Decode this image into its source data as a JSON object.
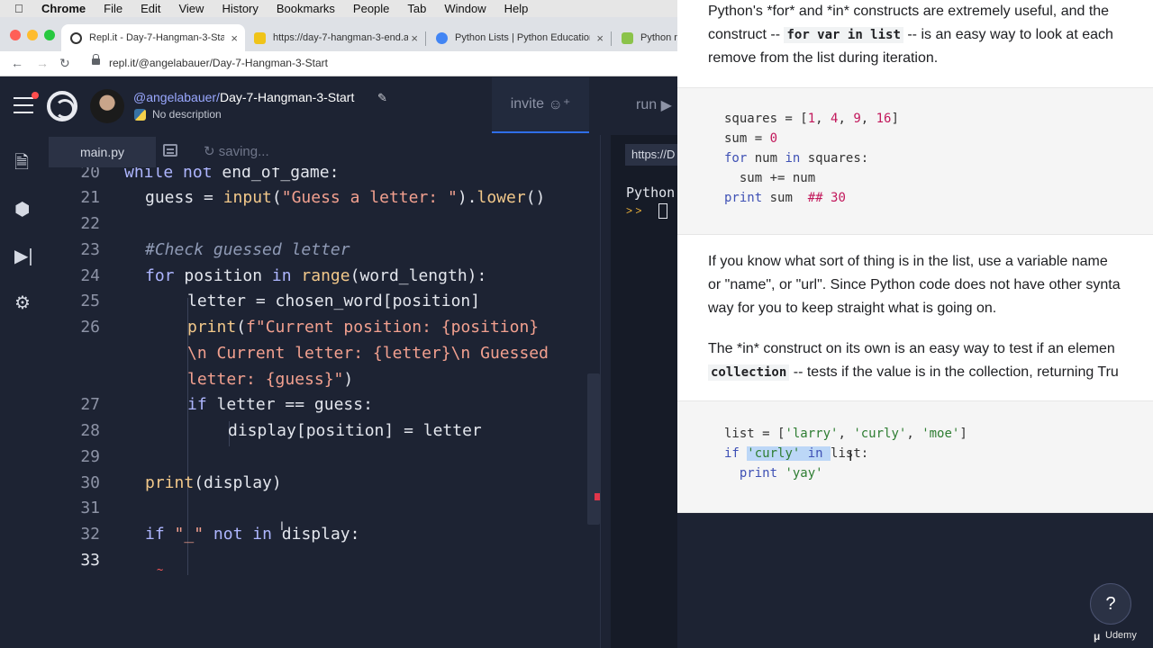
{
  "menubar": {
    "app": "Chrome",
    "items": [
      "File",
      "Edit",
      "View",
      "History",
      "Bookmarks",
      "People",
      "Tab",
      "Window",
      "Help"
    ]
  },
  "browser": {
    "tabs": [
      {
        "title": "Repl.it - Day-7-Hangman-3-Start",
        "close": "×"
      },
      {
        "title": "https://day-7-hangman-3-end.a",
        "close": "×"
      },
      {
        "title": "Python Lists | Python Education",
        "close": "×"
      },
      {
        "title": "Python nc",
        "close": ""
      }
    ],
    "url": "repl.it/@angelabauer/Day-7-Hangman-3-Start",
    "colors": {
      "close": "#ff5f57",
      "minimize": "#febc2e",
      "maximize": "#28c840"
    }
  },
  "repl": {
    "owner": "@angelabauer/",
    "name": "Day-7-Hangman-3-Start",
    "description": "No description",
    "invite_label": "invite",
    "run_label": "run"
  },
  "editor": {
    "file_tab": "main.py",
    "save_status": "saving...",
    "lines": [
      {
        "n": "20",
        "text": "while not end_of_game:"
      },
      {
        "n": "21",
        "text": "  guess = input(\"Guess a letter: \").lower()"
      },
      {
        "n": "22",
        "text": ""
      },
      {
        "n": "23",
        "text": "  #Check guessed letter"
      },
      {
        "n": "24",
        "text": "  for position in range(word_length):"
      },
      {
        "n": "25",
        "text": "      letter = chosen_word[position]"
      },
      {
        "n": "26",
        "text": "      print(f\"Current position: {position}"
      },
      {
        "n": "",
        "text": "      \\n Current letter: {letter}\\n Guessed"
      },
      {
        "n": "",
        "text": "      letter: {guess}\")"
      },
      {
        "n": "27",
        "text": "      if letter == guess:"
      },
      {
        "n": "28",
        "text": "          display[position] = letter"
      },
      {
        "n": "29",
        "text": ""
      },
      {
        "n": "30",
        "text": "  print(display)"
      },
      {
        "n": "31",
        "text": ""
      },
      {
        "n": "32",
        "text": "  if \"_\" not in display:"
      },
      {
        "n": "33",
        "text": ""
      }
    ]
  },
  "console": {
    "url": "https://D",
    "output": "Python",
    "prompt": "> >"
  },
  "doc": {
    "intro": [
      "Python's *for* and *in* constructs are extremely useful, and the",
      "construct -- ",
      "for var in list",
      " -- is an easy way to look at each",
      "remove from the list during iteration."
    ],
    "code1": [
      "squares = [1, 4, 9, 16]",
      "sum = 0",
      "for num in squares:",
      "  sum += num",
      "print sum  ## 30"
    ],
    "para2": [
      "If you know what sort of thing is in the list, use a variable name",
      "or \"name\", or \"url\". Since Python code does not have other synta",
      "way for you to keep straight what is going on."
    ],
    "para3_line1": "The *in* construct on its own is an easy way to test if an elemen",
    "para3_code": "collection",
    "para3_rest": " -- tests if the value is in the collection, returning Tru",
    "code2": [
      "list = ['larry', 'curly', 'moe']",
      "if 'curly' in list:",
      "  print 'yay'"
    ]
  },
  "help_label": "?",
  "watermark": "Udemy"
}
